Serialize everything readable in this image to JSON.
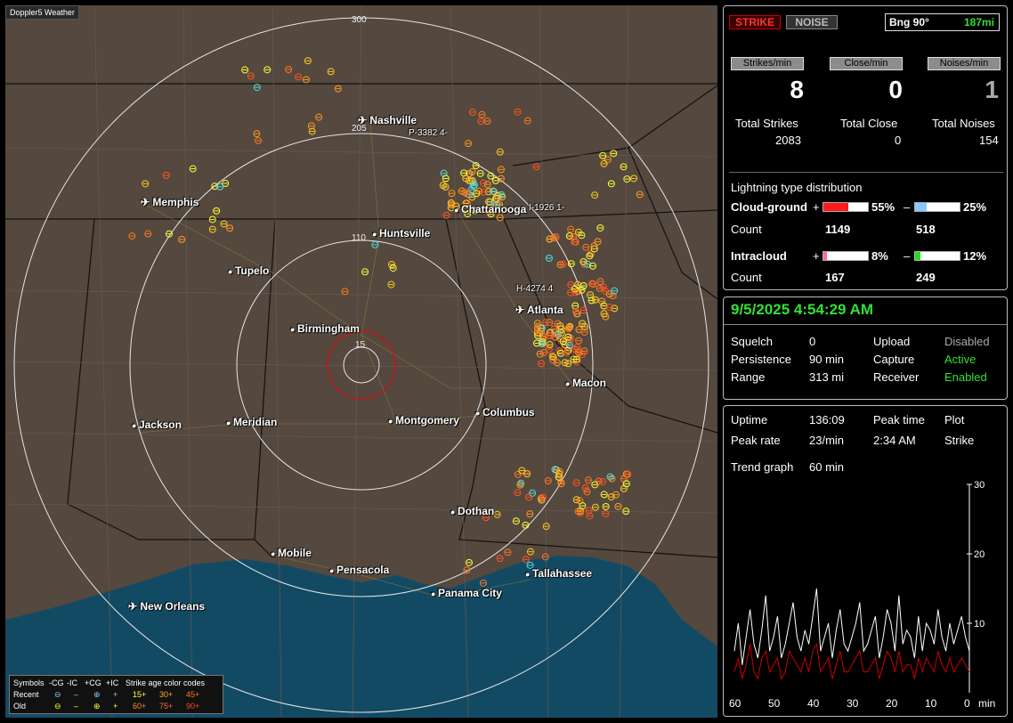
{
  "app_title": "Doppler5 Weather",
  "colors": {
    "strike_red": "#cc0000",
    "clock_green": "#33e033",
    "cg_pos": "#ff1a1a",
    "cg_neg": "#88c8ff",
    "ic_pos": "#ff66aa",
    "ic_neg": "#22dd22"
  },
  "map": {
    "ring_labels": [
      "300",
      "205",
      "110",
      "15"
    ],
    "cities": [
      {
        "name": "Nashville",
        "icon": "airport-icon"
      },
      {
        "name": "Memphis",
        "icon": "airport-icon"
      },
      {
        "name": "Chattanooga",
        "icon": "dot-icon"
      },
      {
        "name": "Huntsville",
        "icon": "dot-icon"
      },
      {
        "name": "Tupelo",
        "icon": "dot-icon"
      },
      {
        "name": "Atlanta",
        "icon": "airport-icon"
      },
      {
        "name": "Birmingham",
        "icon": "dot-icon"
      },
      {
        "name": "Macon",
        "icon": "dot-icon"
      },
      {
        "name": "Jackson",
        "icon": "dot-icon"
      },
      {
        "name": "Meridian",
        "icon": "dot-icon"
      },
      {
        "name": "Montgomery",
        "icon": "dot-icon"
      },
      {
        "name": "Columbus",
        "icon": "dot-icon"
      },
      {
        "name": "Dothan",
        "icon": "dot-icon"
      },
      {
        "name": "Mobile",
        "icon": "dot-icon"
      },
      {
        "name": "Pensacola",
        "icon": "dot-icon"
      },
      {
        "name": "Tallahassee",
        "icon": "dot-icon"
      },
      {
        "name": "Panama City",
        "icon": "dot-icon"
      },
      {
        "name": "New Orleans",
        "icon": "airport-icon"
      }
    ],
    "markers": [
      "P-3382 4-",
      "I-1926 1-",
      "H-4274 4"
    ],
    "legend": {
      "row0": [
        "Symbols",
        "-CG",
        "-IC",
        "+CG",
        "+IC",
        "Strike age color codes"
      ],
      "recent_label": "Recent",
      "old_label": "Old",
      "recent_ages": [
        "15+",
        "30+",
        "45+"
      ],
      "old_ages": [
        "60+",
        "75+",
        "90+"
      ]
    }
  },
  "header": {
    "strike": "STRIKE",
    "noise": "NOISE",
    "bearing": "Bng 90°",
    "distance": "187mi"
  },
  "rates": {
    "strikes_label": "Strikes/min",
    "close_label": "Close/min",
    "noises_label": "Noises/min",
    "strikes": "8",
    "close": "0",
    "noises": "1",
    "total_strikes_label": "Total Strikes",
    "total_close_label": "Total Close",
    "total_noises_label": "Total Noises",
    "total_strikes": "2083",
    "total_close": "0",
    "total_noises": "154"
  },
  "distribution": {
    "title": "Lightning type distribution",
    "cg_label": "Cloud-ground",
    "ic_label": "Intracloud",
    "plus": "+",
    "minus": "–",
    "count_label": "Count",
    "cg_pos_pct": "55%",
    "cg_neg_pct": "25%",
    "cg_pos_count": "1149",
    "cg_neg_count": "518",
    "ic_pos_pct": "8%",
    "ic_neg_pct": "12%",
    "ic_pos_count": "167",
    "ic_neg_count": "249",
    "cg_pos_frac": 0.55,
    "cg_neg_frac": 0.25,
    "ic_pos_frac": 0.08,
    "ic_neg_frac": 0.12
  },
  "status": {
    "datetime": "9/5/2025 4:54:29 AM",
    "squelch_label": "Squelch",
    "squelch": "0",
    "persistence_label": "Persistence",
    "persistence": "90 min",
    "range_label": "Range",
    "range": "313 mi",
    "upload_label": "Upload",
    "upload": "Disabled",
    "capture_label": "Capture",
    "capture": "Active",
    "receiver_label": "Receiver",
    "receiver": "Enabled"
  },
  "stats": {
    "uptime_label": "Uptime",
    "uptime": "136:09",
    "peak_time_label": "Peak time",
    "peak_time": "2:34 AM",
    "plot_label": "Plot",
    "plot": "Strike",
    "peak_rate_label": "Peak rate",
    "peak_rate": "23/min",
    "trend_label": "Trend graph",
    "trend": "60 min"
  },
  "chart_data": {
    "type": "line",
    "x": [
      60,
      50,
      40,
      30,
      20,
      10,
      0
    ],
    "xlabel": "min",
    "ylim": [
      0,
      30
    ],
    "y_ticks": [
      "30",
      "20",
      "10"
    ],
    "series": [
      {
        "values": [
          6,
          10,
          4,
          8,
          12,
          7,
          5,
          9,
          14,
          6,
          8,
          11,
          5,
          7,
          10,
          13,
          8,
          6,
          9,
          7,
          11,
          15,
          6,
          8,
          10,
          5,
          9,
          12,
          7,
          6,
          8,
          10,
          13,
          6,
          7,
          9,
          11,
          5,
          8,
          12,
          10,
          6,
          14,
          7,
          9,
          8,
          5,
          11,
          6,
          10,
          9,
          7,
          12,
          8,
          6,
          10,
          7,
          9,
          11,
          8,
          6
        ]
      },
      {
        "values": [
          3,
          5,
          2,
          4,
          7,
          3,
          2,
          5,
          6,
          3,
          4,
          5,
          2,
          3,
          6,
          5,
          4,
          3,
          5,
          3,
          6,
          7,
          3,
          4,
          5,
          2,
          4,
          6,
          3,
          3,
          4,
          5,
          6,
          3,
          3,
          4,
          5,
          2,
          4,
          6,
          5,
          3,
          6,
          3,
          4,
          4,
          2,
          5,
          3,
          5,
          4,
          3,
          6,
          4,
          3,
          5,
          3,
          4,
          5,
          4,
          3
        ]
      }
    ]
  }
}
